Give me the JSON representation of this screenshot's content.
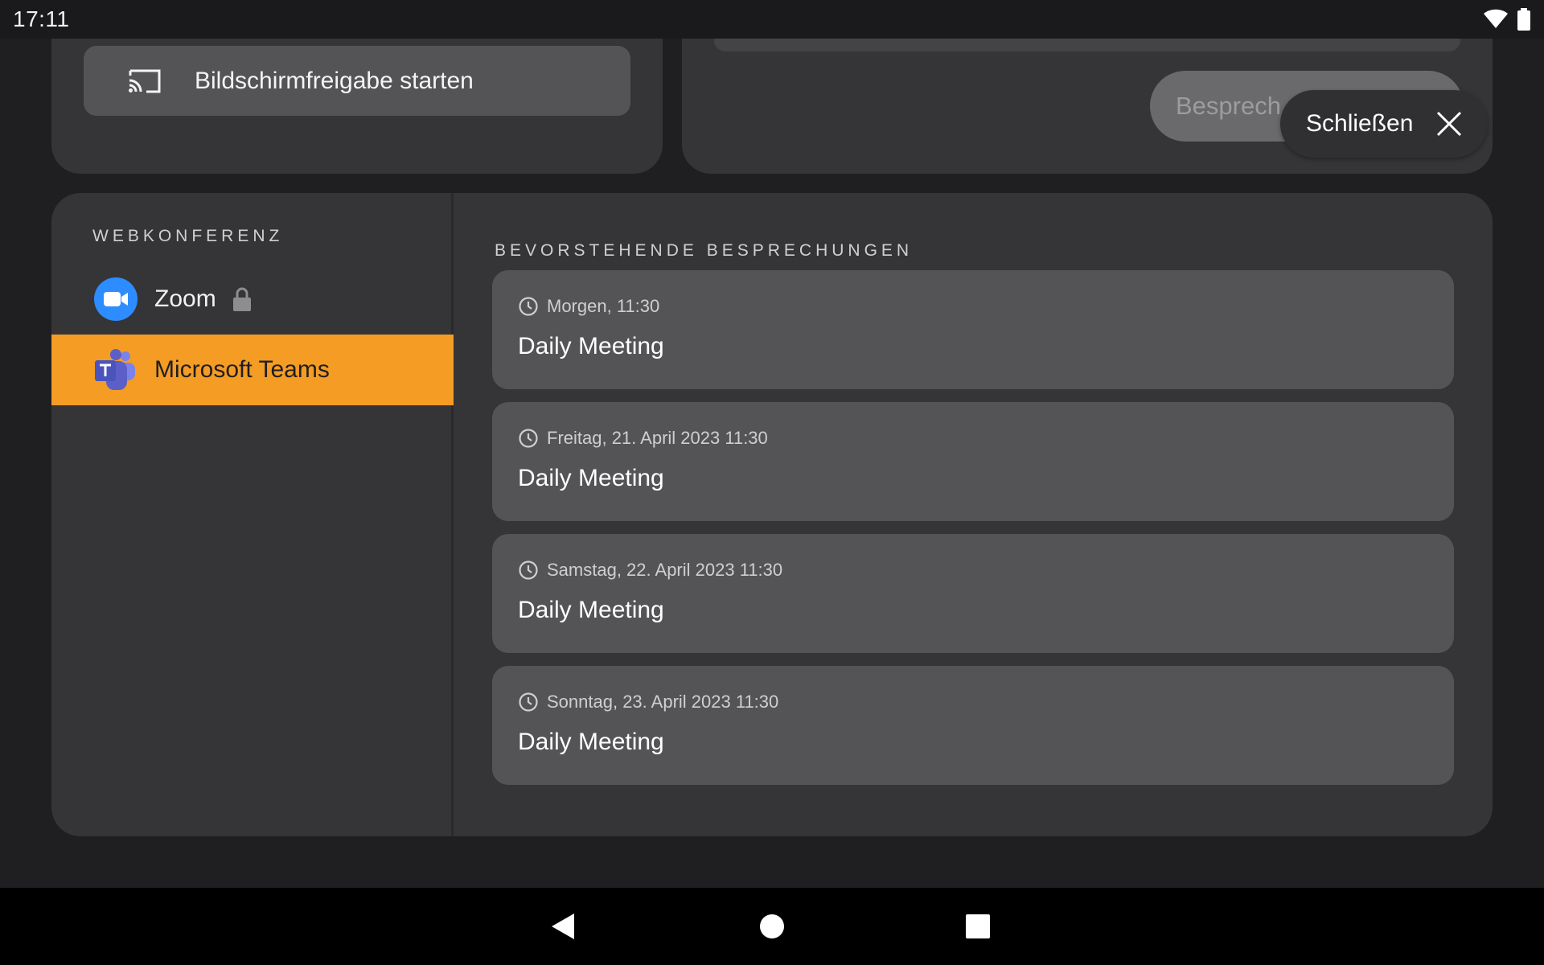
{
  "status_bar": {
    "time": "17:11"
  },
  "screen_share": {
    "label": "Bildschirmfreigabe starten"
  },
  "meeting_form": {
    "button_label": "Besprech"
  },
  "close_button": {
    "label": "Schließen"
  },
  "sidebar": {
    "section_title": "WEBKONFERENZ",
    "items": [
      {
        "label": "Zoom",
        "locked": true,
        "active": false
      },
      {
        "label": "Microsoft Teams",
        "locked": false,
        "active": true
      }
    ]
  },
  "upcoming": {
    "section_title": "BEVORSTEHENDE BESPRECHUNGEN",
    "meetings": [
      {
        "time": "Morgen, 11:30",
        "title": "Daily Meeting"
      },
      {
        "time": "Freitag, 21. April 2023 11:30",
        "title": "Daily Meeting"
      },
      {
        "time": "Samstag, 22. April 2023 11:30",
        "title": "Daily Meeting"
      },
      {
        "time": "Sonntag, 23. April 2023 11:30",
        "title": "Daily Meeting"
      }
    ]
  },
  "colors": {
    "accent": "#f59c24",
    "card": "#353537",
    "item": "#545457",
    "zoom_blue": "#2d8cff",
    "teams_purple": "#5b5fc7"
  }
}
